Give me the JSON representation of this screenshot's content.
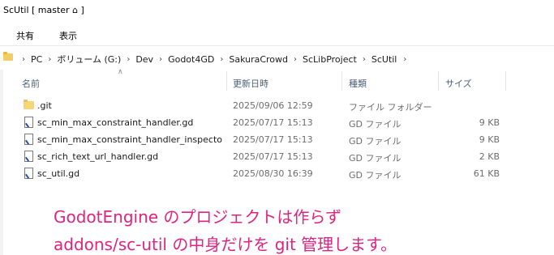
{
  "window": {
    "title": "ScUtil [ master ⌂ ]"
  },
  "ribbon": {
    "tabs": [
      "共有",
      "表示"
    ]
  },
  "address": {
    "crumbs": [
      "PC",
      "ボリューム (G:)",
      "Dev",
      "Godot4GD",
      "SakuraCrowd",
      "ScLibProject",
      "ScUtil"
    ]
  },
  "columns": {
    "name": "名前",
    "date": "更新日時",
    "type": "種類",
    "size": "サイズ"
  },
  "files": [
    {
      "name": ".git",
      "date": "2025/09/06 12:59",
      "type": "ファイル フォルダー",
      "size": "",
      "icon": "folder-icon"
    },
    {
      "name": "sc_min_max_constraint_handler.gd",
      "date": "2025/07/17 15:13",
      "type": "GD ファイル",
      "size": "9 KB",
      "icon": "gd-file-icon"
    },
    {
      "name": "sc_min_max_constraint_handler_inspecto...",
      "date": "2025/07/17 15:13",
      "type": "GD ファイル",
      "size": "9 KB",
      "icon": "gd-file-icon"
    },
    {
      "name": "sc_rich_text_url_handler.gd",
      "date": "2025/07/17 15:13",
      "type": "GD ファイル",
      "size": "2 KB",
      "icon": "gd-file-icon"
    },
    {
      "name": "sc_util.gd",
      "date": "2025/08/30 16:39",
      "type": "GD ファイル",
      "size": "61 KB",
      "icon": "gd-file-icon"
    }
  ],
  "annotation": {
    "line1": "GodotEngine のプロジェクトは作らず",
    "line2": "addons/sc-util の中身だけを git 管理します。",
    "color": "#e0237f"
  }
}
